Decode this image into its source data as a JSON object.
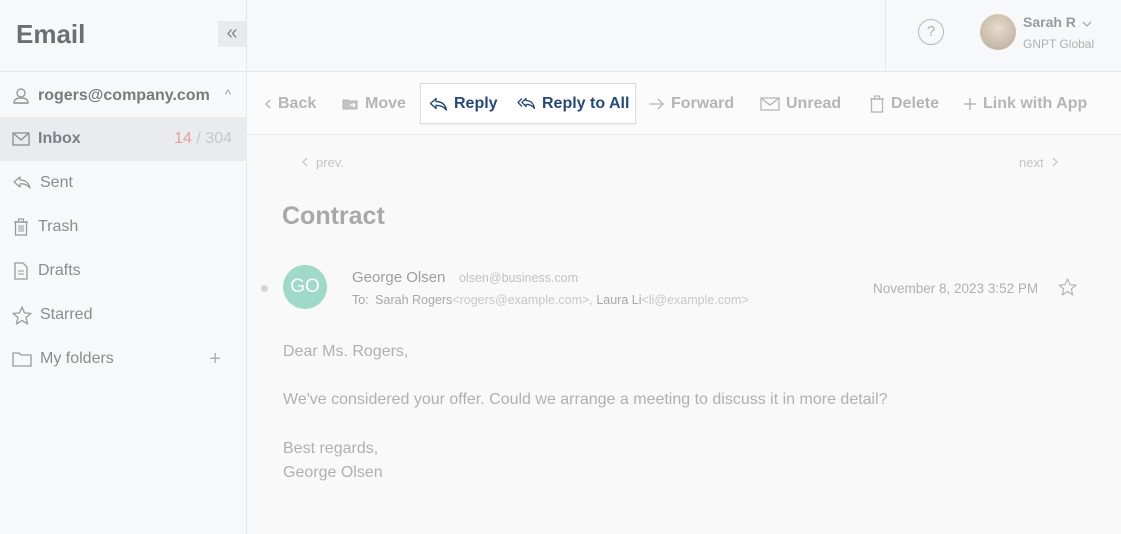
{
  "sidebar": {
    "app_title": "Email",
    "collapse_glyph": "«",
    "account": {
      "label": "rogers@company.com",
      "chevron": "^"
    },
    "items": [
      {
        "label": "Inbox",
        "unread": "14",
        "separator": " / ",
        "total": "304",
        "icon": "envelope-icon"
      },
      {
        "label": "Sent",
        "icon": "reply-icon"
      },
      {
        "label": "Trash",
        "icon": "trash-icon"
      },
      {
        "label": "Drafts",
        "icon": "document-icon"
      },
      {
        "label": "Starred",
        "icon": "star-icon"
      },
      {
        "label": "My folders",
        "icon": "folder-icon",
        "action": "+"
      }
    ]
  },
  "header": {
    "help": "?",
    "user": {
      "name": "Sarah R",
      "org": "GNPT Global"
    }
  },
  "toolbar": {
    "back": "Back",
    "move": "Move",
    "reply": "Reply",
    "reply_all": "Reply to All",
    "forward": "Forward",
    "unread": "Unread",
    "delete": "Delete",
    "link": "Link with App"
  },
  "message": {
    "prev": "prev.",
    "next": "next",
    "subject": "Contract",
    "sender_initials": "GO",
    "sender_name": "George Olsen",
    "sender_email": "olsen@business.com",
    "to_label": "To:",
    "recipient1_name": "Sarah Rogers",
    "recipient1_email": "<rogers@example.com>",
    "recipient_sep": ",",
    "recipient2_name": "Laura Li",
    "recipient2_email": "<li@example.com>",
    "date": "November 8, 2023 3:52 PM",
    "body": [
      "Dear Ms. Rogers,",
      "We've considered your offer. Could we arrange a meeting to discuss it in more detail?",
      "Best regards,",
      "George Olsen"
    ]
  },
  "colors": {
    "accent": "#234a7a",
    "unread_count": "#e8a0a0",
    "avatar_bg": "#9fd9c7"
  }
}
